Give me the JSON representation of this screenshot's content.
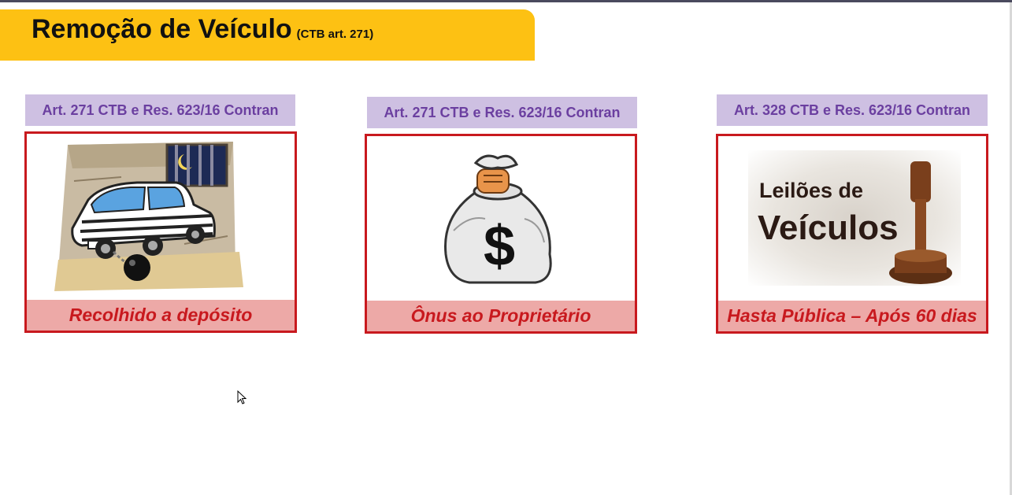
{
  "header": {
    "title": "Remoção de Veículo",
    "subtitle": "(CTB art. 271)"
  },
  "cards": [
    {
      "ref": "Art. 271 CTB e Res. 623/16 Contran",
      "caption": "Recolhido a depósito",
      "image": "impounded-car-illustration"
    },
    {
      "ref": "Art. 271 CTB e Res. 623/16 Contran",
      "caption": "Ônus ao Proprietário",
      "image": "money-bag-illustration"
    },
    {
      "ref": "Art. 328 CTB e Res. 623/16 Contran",
      "caption": "Hasta Pública – Após 60 dias",
      "image": "vehicle-auction-illustration",
      "image_text": {
        "line1": "Leilões de",
        "line2": "Veículos"
      }
    }
  ],
  "colors": {
    "banner": "#fdc113",
    "ref_background": "#cec0e2",
    "ref_text": "#6b3fa0",
    "card_border": "#c8191e",
    "caption_background": "#eda9a7",
    "caption_text": "#c8191e"
  }
}
